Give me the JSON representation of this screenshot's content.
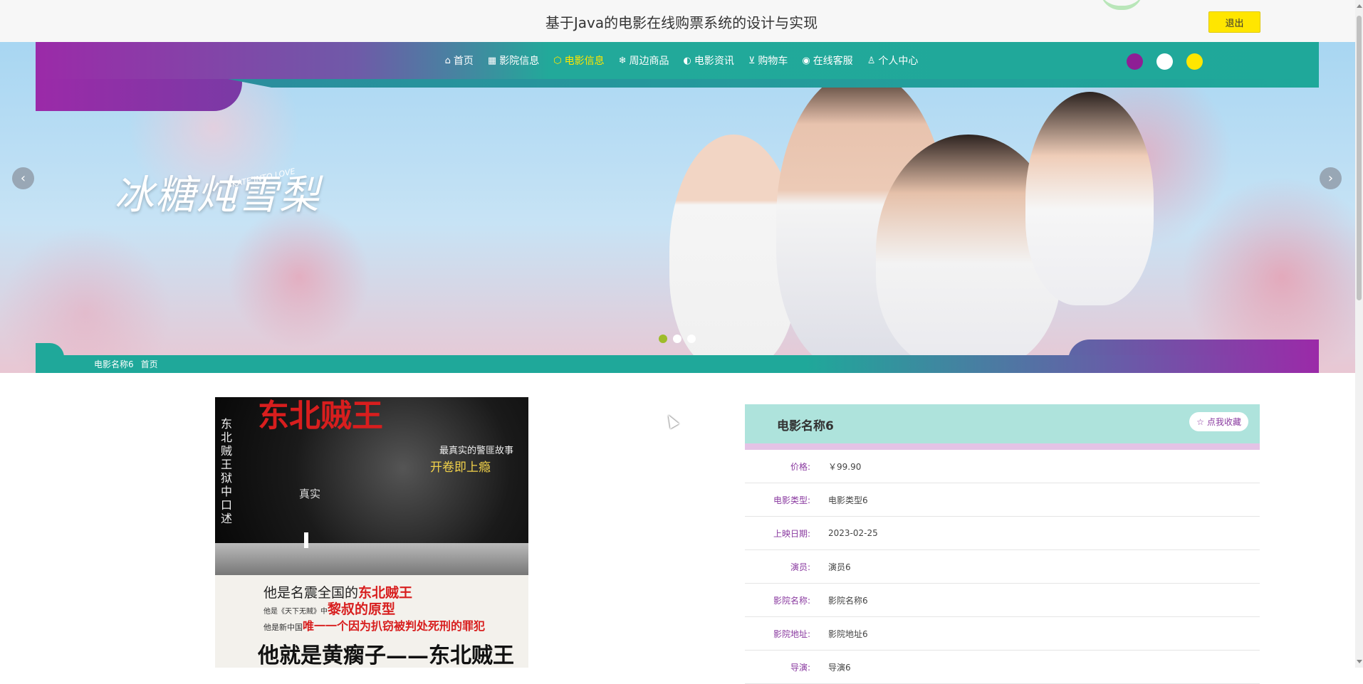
{
  "header": {
    "title": "基于Java的电影在线购票系统的设计与实现",
    "logout_label": "退出"
  },
  "nav": {
    "items": [
      {
        "label": "首页",
        "icon": "home-icon",
        "glyph": "⌂",
        "active": false
      },
      {
        "label": "影院信息",
        "icon": "grid-icon",
        "glyph": "▦",
        "active": false
      },
      {
        "label": "电影信息",
        "icon": "cube-icon",
        "glyph": "⬡",
        "active": true
      },
      {
        "label": "周边商品",
        "icon": "snowflake-icon",
        "glyph": "❄",
        "active": false
      },
      {
        "label": "电影资讯",
        "icon": "palette-icon",
        "glyph": "◐",
        "active": false
      },
      {
        "label": "购物车",
        "icon": "cart-icon",
        "glyph": "⊻",
        "active": false
      },
      {
        "label": "在线客服",
        "icon": "chat-icon",
        "glyph": "◉",
        "active": false
      },
      {
        "label": "个人中心",
        "icon": "user-icon",
        "glyph": "♙",
        "active": false
      }
    ],
    "theme_colors": [
      "#8e1f95",
      "#ffffff",
      "#ffe600"
    ]
  },
  "carousel": {
    "title_art": "冰糖炖雪梨",
    "subtitle_art": "SKATE INTO LOVE",
    "prev_icon": "chevron-left-icon",
    "next_icon": "chevron-right-icon",
    "slides": 3,
    "active_slide": 1
  },
  "breadcrumb": {
    "items": [
      "电影名称6",
      "首页"
    ]
  },
  "poster": {
    "headline": "东北贼王",
    "vertical_text": "东北贼王狱中口述",
    "tag1": "最真实的警匪故事",
    "tag2": "开卷即上瘾",
    "mid_text": "真实",
    "line1_a": "他是名震全国的",
    "line1_b": "东北贼王",
    "line2_a": "他是《天下无贼》中",
    "line2_b": "黎叔的原型",
    "line3_a": "他是新中国",
    "line3_b": "唯一一个因为扒窃被判处死刑的罪犯",
    "line4": "他就是黄瘸子——东北贼王"
  },
  "detail": {
    "title": "电影名称6",
    "favorite_label": "点我收藏",
    "favorite_icon": "star-icon",
    "rows": [
      {
        "label": "价格:",
        "value": "￥99.90"
      },
      {
        "label": "电影类型:",
        "value": "电影类型6"
      },
      {
        "label": "上映日期:",
        "value": "2023-02-25"
      },
      {
        "label": "演员:",
        "value": "演员6"
      },
      {
        "label": "影院名称:",
        "value": "影院名称6"
      },
      {
        "label": "影院地址:",
        "value": "影院地址6"
      },
      {
        "label": "导演:",
        "value": "导演6"
      }
    ]
  }
}
